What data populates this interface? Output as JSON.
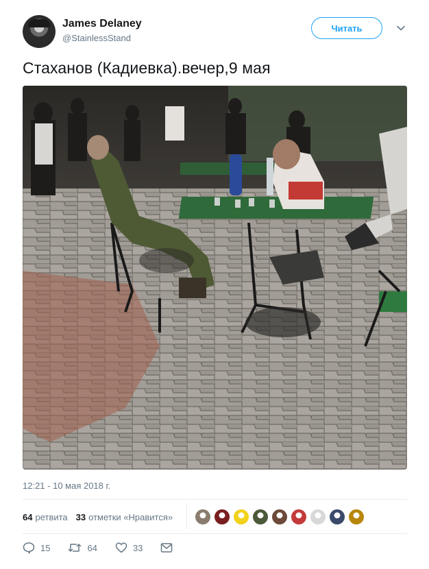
{
  "user": {
    "name": "James Delaney",
    "handle": "@StainlessStand"
  },
  "follow_label": "Читать",
  "tweet_text": "Стаханов (Кадиевка).вечер,9 мая",
  "timestamp": "12:21 - 10 мая 2018 г.",
  "stats": {
    "retweets_count": "64",
    "retweets_label": "ретвита",
    "likes_count": "33",
    "likes_label": "отметки «Нравится»"
  },
  "likers": [
    {
      "icon": "avatar-1",
      "color": "#8a7d6e"
    },
    {
      "icon": "avatar-2",
      "color": "#7a1f1f"
    },
    {
      "icon": "avatar-ukraine-flag",
      "color": "#f2d21b"
    },
    {
      "icon": "avatar-4",
      "color": "#4b5a3a"
    },
    {
      "icon": "avatar-5",
      "color": "#6d4a3a"
    },
    {
      "icon": "avatar-6",
      "color": "#c43b3b"
    },
    {
      "icon": "avatar-7",
      "color": "#d8d8d8"
    },
    {
      "icon": "avatar-8",
      "color": "#3a4a6a"
    },
    {
      "icon": "avatar-9",
      "color": "#b8860b"
    }
  ],
  "actions": {
    "replies": "15",
    "retweets": "64",
    "likes": "33"
  },
  "colors": {
    "accent": "#1da1f2",
    "muted": "#657786",
    "text": "#14171a",
    "divider": "#e6ecf0"
  }
}
